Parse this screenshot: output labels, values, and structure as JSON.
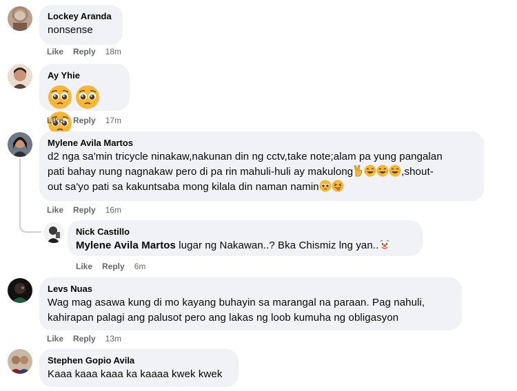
{
  "comments": [
    {
      "author": "Lockey Aranda",
      "text": "nonsense",
      "like": "Like",
      "reply": "Reply",
      "time": "18m"
    },
    {
      "author": "Ay Yhie",
      "like": "Like",
      "reply": "Reply",
      "time": "17m"
    },
    {
      "author": "Mylene Avila Martos",
      "line1": "d2 nga sa'min tricycle ninakaw,nakunan din ng cctv,take note;alam pa yung pangalan",
      "line2": "pati bahay nung nagnakaw pero di pa rin mahuli-huli ay makulong",
      "line2b": ",shout-",
      "line3": "out sa'yo pati sa kakuntsaba mong kilala din naman namin",
      "like": "Like",
      "reply": "Reply",
      "time": "16m"
    },
    {
      "author": "Nick Castillo",
      "mention": "Mylene Avila Martos",
      "text": " lugar ng Nakawan..? Bka Chismiz lng yan..",
      "like": "Like",
      "reply": "Reply",
      "time": "6m"
    },
    {
      "author": "Levs Nuas",
      "line1": "Wag mag asawa kung di mo kayang buhayin sa marangal na paraan. Pag nahuli,",
      "line2": "kahirapan palagi ang palusot pero ang lakas ng loob kumuha ng obligasyon",
      "like": "Like",
      "reply": "Reply",
      "time": "13m"
    },
    {
      "author": "Stephen Gopio Avila",
      "text": "Kaaa kaaa kaaa ka kaaaa kwek kwek"
    }
  ]
}
